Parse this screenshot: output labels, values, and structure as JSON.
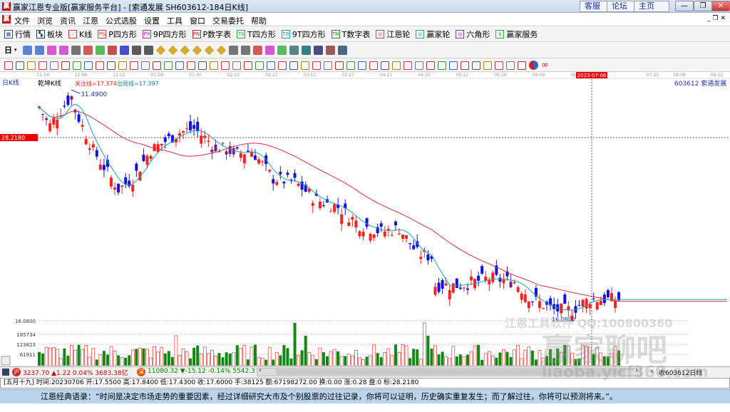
{
  "window": {
    "title": "赢家江恩专业版[赢家服务平台] - [索通发展  SH603612-184日K线]",
    "links": [
      "客服",
      "论坛",
      "主页"
    ]
  },
  "menu": [
    "文件",
    "浏览",
    "资讯",
    "江恩",
    "公式选股",
    "设置",
    "工具",
    "窗口",
    "交易委托",
    "帮助"
  ],
  "toolbar1": [
    "行情",
    "板块",
    "K线",
    "P四方形",
    "9P四方形",
    "P数字表",
    "T四方形",
    "9T四方形",
    "T数字表",
    "江恩轮",
    "赢家轮",
    "六角形",
    "赢家服务"
  ],
  "toolbar1_icons": [
    "PS",
    "P9",
    "PN",
    "TS",
    "T9",
    "TN"
  ],
  "period": "日",
  "chart": {
    "period_label": "日K线",
    "indicator_name": "乾坤K线",
    "focus_line": "关注线=17.374",
    "exit_line": "出局线=17.397",
    "high_label": "31.4900",
    "low_label": "16.0800",
    "cursor_price": "28.2180",
    "cursor_date": "2023-07-06",
    "stock": "603612  索通发展",
    "dates": [
      "11-24",
      "12-08",
      "12-22",
      "01-09",
      "01-30",
      "02-13",
      "02-27",
      "03-13",
      "03-27",
      "04-11",
      "04-25",
      "05-12",
      "05-26",
      "06-09",
      "06-27",
      "07-25",
      "08-08",
      "08-22"
    ],
    "volume_ticks": [
      "16.0800",
      "185734",
      "123823",
      "61911"
    ],
    "keypoints": [
      [
        0,
        30.43
      ],
      [
        3,
        29.23
      ],
      [
        8,
        30.91
      ],
      [
        9,
        31.15
      ],
      [
        11,
        29.71
      ],
      [
        15,
        27.54
      ],
      [
        22,
        24.89
      ],
      [
        26,
        25.62
      ],
      [
        31,
        27.54
      ],
      [
        39,
        28.75
      ],
      [
        43,
        28.99
      ],
      [
        49,
        27.78
      ],
      [
        55,
        27.3
      ],
      [
        59,
        27.54
      ],
      [
        65,
        25.62
      ],
      [
        71,
        25.38
      ],
      [
        77,
        24.17
      ],
      [
        83,
        23.69
      ],
      [
        89,
        22.49
      ],
      [
        95,
        22.01
      ],
      [
        100,
        22.25
      ],
      [
        105,
        20.56
      ],
      [
        109,
        20.32
      ],
      [
        110,
        18.39
      ],
      [
        117,
        18.39
      ],
      [
        125,
        18.88
      ],
      [
        132,
        18.63
      ],
      [
        137,
        17.43
      ],
      [
        143,
        16.71
      ],
      [
        148,
        16.71
      ],
      [
        151,
        17.19
      ],
      [
        153,
        17.43
      ],
      [
        161,
        17.43
      ]
    ],
    "price_range": [
      16.08,
      31.49
    ],
    "colors": {
      "up": "#ff2020",
      "down": "#1010e0",
      "neutral": "#7a2080",
      "ma_slow": "#d03040",
      "ma_fast": "#20a0a0"
    }
  },
  "watermark": {
    "line1": "江恩工具软件  QQ:100800360",
    "line2": "赢家聊吧",
    "line3": "liaoba.yicf360.com"
  },
  "status": {
    "sh": "3237.70 ▲1.22 0.04% 3683.38亿",
    "sz": "11080.32 ▼-15.12 -0.14% 5542.38",
    "right": "收603612日线"
  },
  "info": "[五月十九] 时间:20230706 开:17.5500 高:17.8400 低:17.4300 收:17.6000 手:38125 额:67198272.00 换:0.00 涨:0.28 盘:0 标:28.2180",
  "quote": "江恩经典语录：“时间是决定市场走势的重要因素，经过详细研究大市及个别股票的过往记录，你将可以证明，历史确实重复发生；而了解过往，你将可以预测将来。”。"
}
